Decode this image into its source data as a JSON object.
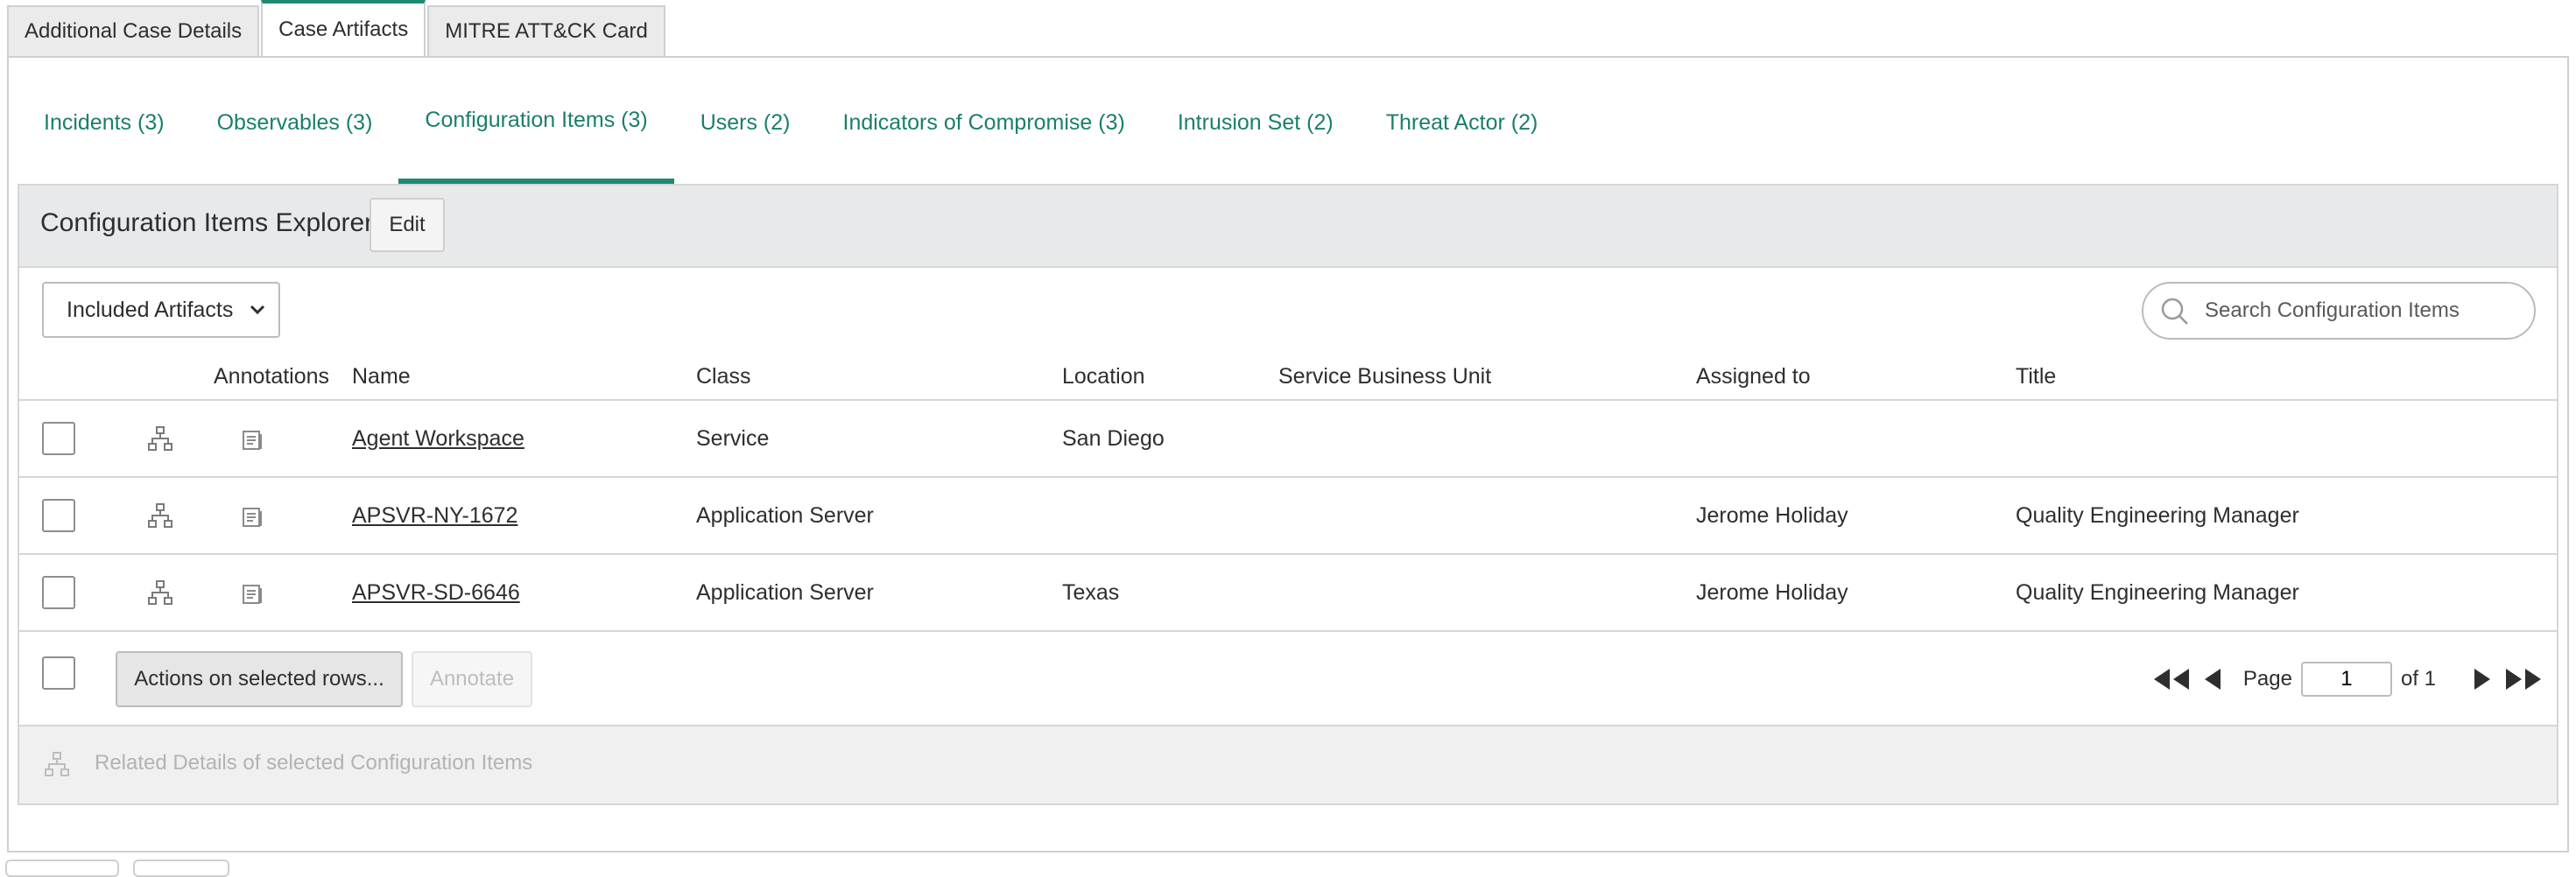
{
  "top_tabs": [
    {
      "label": "Additional Case Details",
      "active": false
    },
    {
      "label": "Case Artifacts",
      "active": true
    },
    {
      "label": "MITRE ATT&CK Card",
      "active": false
    }
  ],
  "sub_tabs": [
    {
      "label": "Incidents (3)",
      "active": false
    },
    {
      "label": "Observables (3)",
      "active": false
    },
    {
      "label": "Configuration Items (3)",
      "active": true
    },
    {
      "label": "Users (2)",
      "active": false
    },
    {
      "label": "Indicators of Compromise (3)",
      "active": false
    },
    {
      "label": "Intrusion Set (2)",
      "active": false
    },
    {
      "label": "Threat Actor (2)",
      "active": false
    }
  ],
  "explorer": {
    "title": "Configuration Items Explorer",
    "edit_label": "Edit",
    "filter_selected": "Included Artifacts",
    "search_placeholder": "Search Configuration Items"
  },
  "table": {
    "headers": [
      "Annotations",
      "Name",
      "Class",
      "Location",
      "Service Business Unit",
      "Assigned to",
      "Title"
    ],
    "rows": [
      {
        "name": "Agent Workspace",
        "class": "Service",
        "location": "San Diego",
        "sbu": "",
        "assigned_to": "",
        "title": ""
      },
      {
        "name": "APSVR-NY-1672",
        "class": "Application Server",
        "location": "",
        "sbu": "",
        "assigned_to": "Jerome Holiday",
        "title": "Quality Engineering Manager"
      },
      {
        "name": "APSVR-SD-6646",
        "class": "Application Server",
        "location": "Texas",
        "sbu": "",
        "assigned_to": "Jerome Holiday",
        "title": "Quality Engineering Manager"
      }
    ]
  },
  "footer": {
    "actions_label": "Actions on selected rows...",
    "annotate_label": "Annotate",
    "page_label": "Page",
    "page_value": "1",
    "of_label": "of 1"
  },
  "related": {
    "label": "Related Details of selected Configuration Items"
  },
  "colors": {
    "accent": "#1e8a72",
    "link": "#1a7f6a",
    "header_bg": "#e8e9eb"
  }
}
